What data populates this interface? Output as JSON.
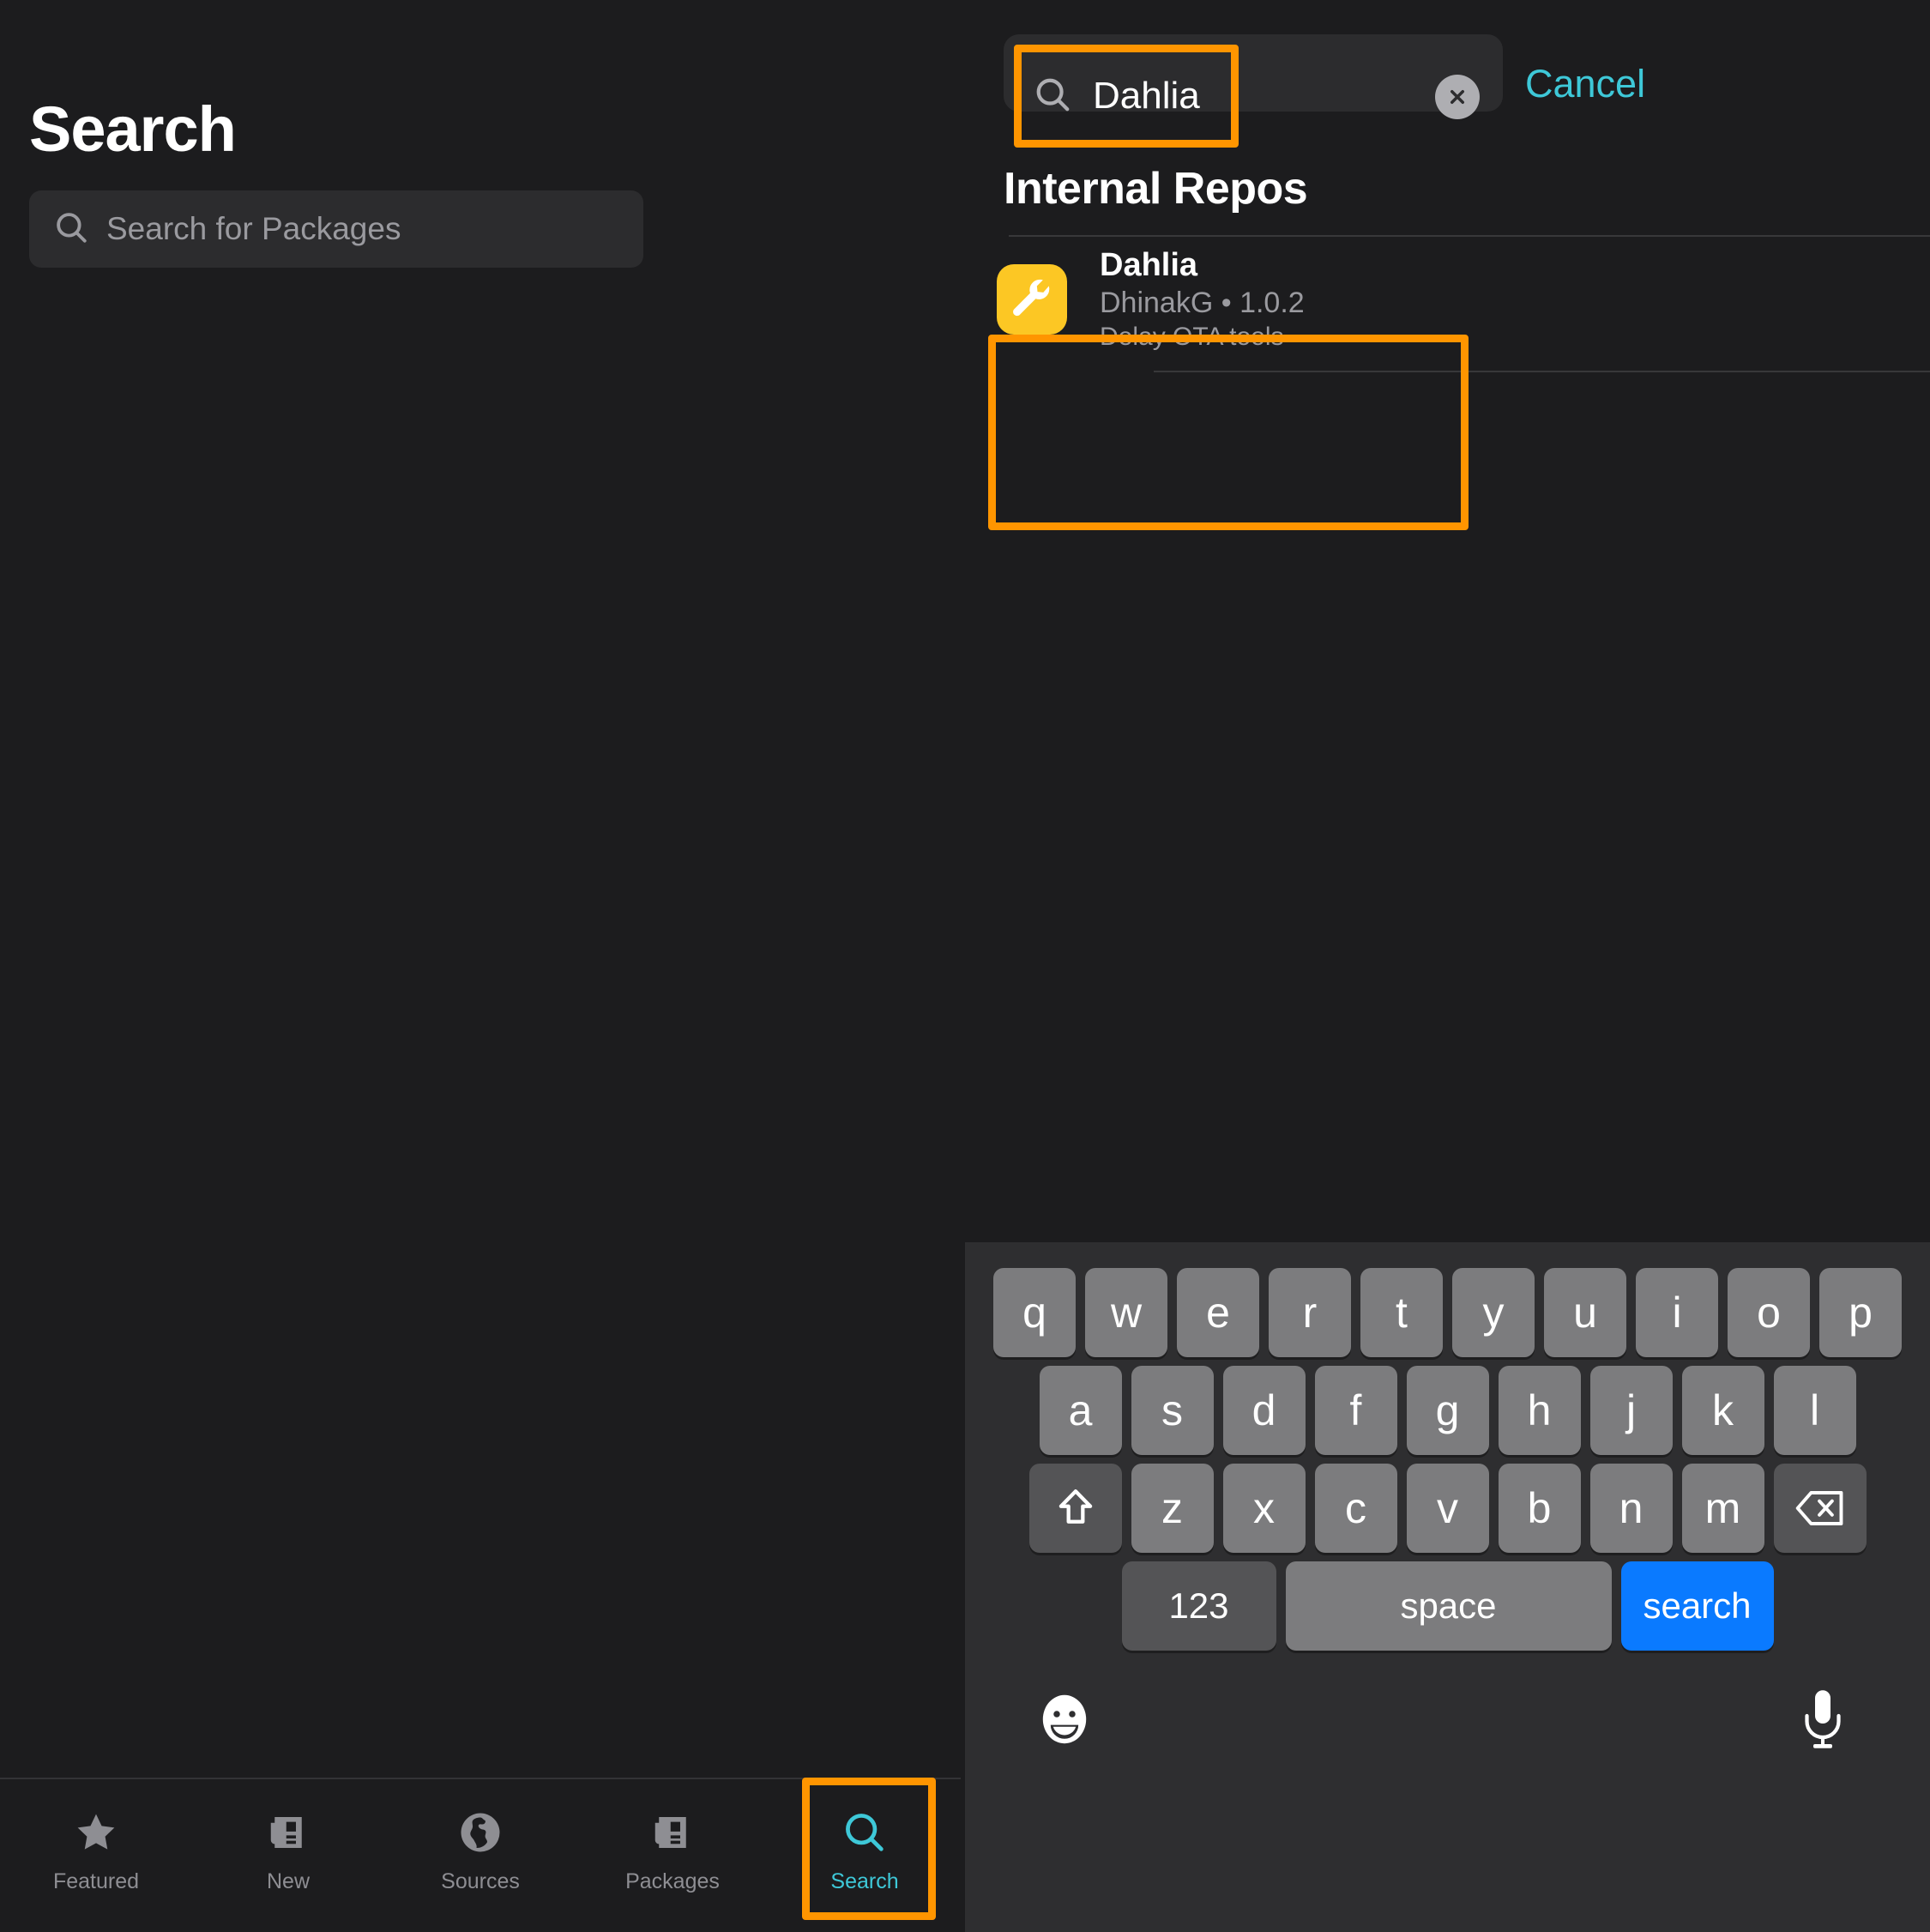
{
  "app": {
    "background_color": "#1c1c1e",
    "accent_teal": "#3ec8d8",
    "highlight_color": "#ff9500",
    "icon_yellow": "#fcc724",
    "key_blue": "#0a7aff"
  },
  "left": {
    "title": "Search",
    "search_placeholder": "Search for Packages",
    "search_value": ""
  },
  "tabs": [
    {
      "label": "Featured",
      "icon": "star-icon",
      "active": false
    },
    {
      "label": "New",
      "icon": "news-icon",
      "active": false
    },
    {
      "label": "Sources",
      "icon": "globe-icon",
      "active": false
    },
    {
      "label": "Packages",
      "icon": "package-icon",
      "active": false
    },
    {
      "label": "Search",
      "icon": "search-icon",
      "active": true
    }
  ],
  "search_bar": {
    "value": "Dahlia",
    "icon": "search-icon",
    "clear_icon": "close-circle-icon",
    "cancel_label": "Cancel"
  },
  "results": {
    "section_header": "Internal Repos",
    "items": [
      {
        "name": "Dahlia",
        "author": "DhinakG",
        "version": "1.0.2",
        "meta": "DhinakG • 1.0.2",
        "description": "Delay OTA tools",
        "icon": "wrench-icon"
      }
    ]
  },
  "keyboard": {
    "row1": [
      "q",
      "w",
      "e",
      "r",
      "t",
      "y",
      "u",
      "i",
      "o",
      "p"
    ],
    "row2": [
      "a",
      "s",
      "d",
      "f",
      "g",
      "h",
      "j",
      "k",
      "l"
    ],
    "row3": [
      "z",
      "x",
      "c",
      "v",
      "b",
      "n",
      "m"
    ],
    "shift_icon": "shift-arrow-icon",
    "delete_icon": "backspace-icon",
    "numbers_label": "123",
    "space_label": "space",
    "return_label": "search",
    "emoji_icon": "emoji-smiley-icon",
    "mic_icon": "microphone-icon"
  }
}
